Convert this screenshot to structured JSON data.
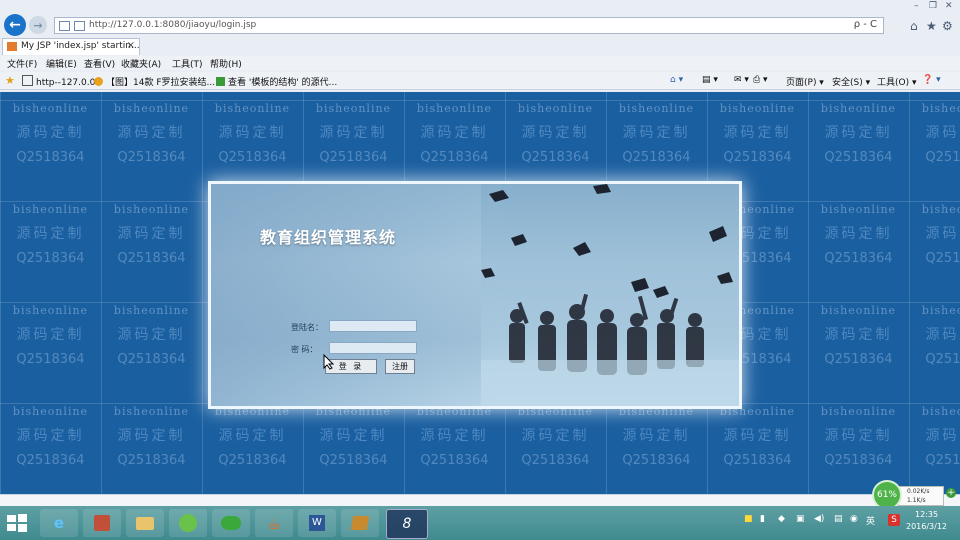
{
  "browser": {
    "url": "http://127.0.0.1:8080/jiaoyu/login.jsp",
    "tab_title": "My JSP 'index.jsp' startin...",
    "tab_close": "×",
    "address_tools": "ρ - C",
    "menu": [
      "文件(F)",
      "编辑(E)",
      "查看(V)",
      "收藏夹(A)",
      "工具(T)",
      "帮助(H)"
    ],
    "favorites": [
      "http--127.0.0",
      "【图】14款 F罗拉安装结...",
      "查看 '模板的结构' 的源代..."
    ],
    "commands": [
      "页面(P) ▾",
      "安全(S) ▾",
      "工具(O) ▾",
      "❓ ▾"
    ]
  },
  "watermark": {
    "line1": "bisheonline",
    "line2": "源码定制",
    "line3": "Q2518364",
    "line3_full": "Q2518364"
  },
  "login": {
    "title": "教育组织管理系统",
    "username_label": "登陆名：",
    "username_value": "",
    "password_label": "密    码：",
    "password_value": "",
    "login_button": "登 录",
    "register_button": "注册"
  },
  "speed": {
    "percent": "61%",
    "up": "0.02K/s",
    "down": "1.1K/s"
  },
  "clock": {
    "time": "12:35",
    "date": "2016/3/12"
  },
  "colors": {
    "page_bg": "#1a5fa0",
    "taskbar": "#4a9498",
    "accent": "#1b72c9"
  }
}
